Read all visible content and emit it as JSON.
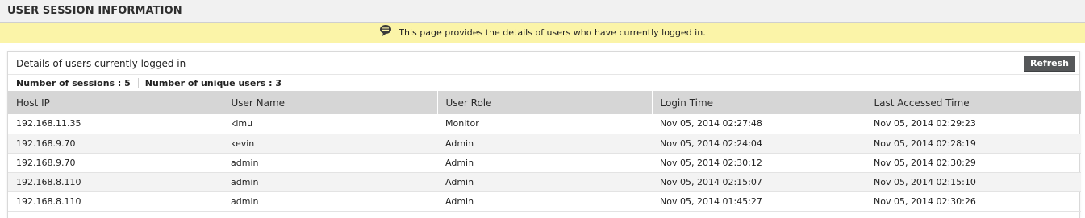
{
  "header": {
    "title": "USER SESSION INFORMATION"
  },
  "info": {
    "icon": "speech-bubble-icon",
    "message": "This page provides the details of users who have currently logged in."
  },
  "panel": {
    "title": "Details of users currently logged in",
    "refresh_label": "Refresh",
    "sessions_label": "Number of sessions : 5",
    "unique_users_label": "Number of unique users : 3"
  },
  "table": {
    "columns": [
      "Host IP",
      "User Name",
      "User Role",
      "Login Time",
      "Last Accessed Time"
    ],
    "rows": [
      [
        "192.168.11.35",
        "kimu",
        "Monitor",
        "Nov 05, 2014 02:27:48",
        "Nov 05, 2014 02:29:23"
      ],
      [
        "192.168.9.70",
        "kevin",
        "Admin",
        "Nov 05, 2014 02:24:04",
        "Nov 05, 2014 02:28:19"
      ],
      [
        "192.168.9.70",
        "admin",
        "Admin",
        "Nov 05, 2014 02:30:12",
        "Nov 05, 2014 02:30:29"
      ],
      [
        "192.168.8.110",
        "admin",
        "Admin",
        "Nov 05, 2014 02:15:07",
        "Nov 05, 2014 02:15:10"
      ],
      [
        "192.168.8.110",
        "admin",
        "Admin",
        "Nov 05, 2014 01:45:27",
        "Nov 05, 2014 02:30:26"
      ]
    ]
  },
  "colors": {
    "info_bar": "#fbf4a8",
    "header_bg": "#f1f1f1",
    "table_header": "#d6d6d6",
    "button": "#555759"
  }
}
